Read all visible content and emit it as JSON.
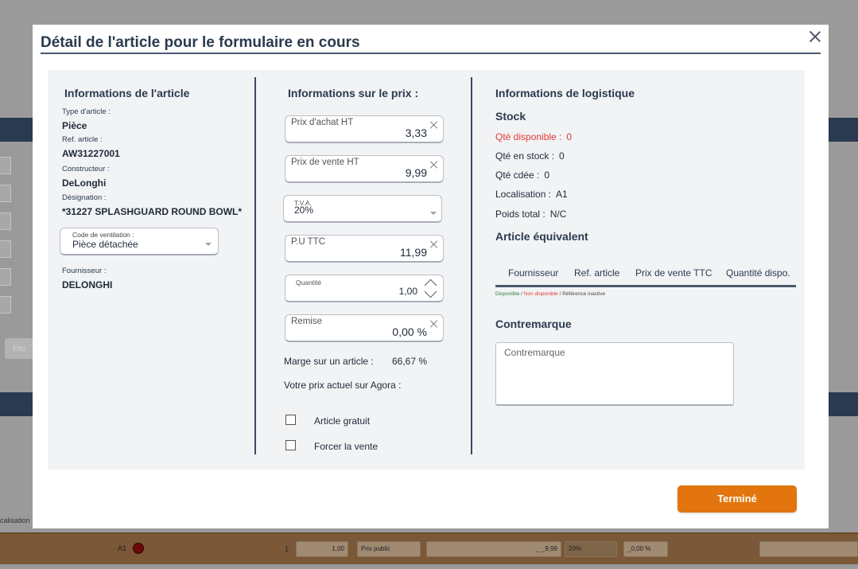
{
  "background": {
    "effacer_label": "Effa",
    "localisation_label": "calisation",
    "row": {
      "location": "A1",
      "qty_index": "1",
      "qty": "1,00",
      "price_type": "Prix public",
      "price": "_ _9,99",
      "tva": "20%",
      "remise": "_0,00 %"
    }
  },
  "modal": {
    "title": "Détail de l'article pour le formulaire en cours",
    "article": {
      "heading": "Informations de l'article",
      "type_label": "Type d'article :",
      "type_value": "Pièce",
      "ref_label": "Ref. article :",
      "ref_value": "AW31227001",
      "constructeur_label": "Constructeur :",
      "constructeur_value": "DeLonghi",
      "designation_label": "Désignation :",
      "designation_value": "*31227 SPLASHGUARD ROUND BOWL*",
      "ventilation_label": "Code de ventilation :",
      "ventilation_value": "Pièce détachée",
      "fournisseur_label": "Fournisseur :",
      "fournisseur_value": "DELONGHI"
    },
    "prix": {
      "heading": "Informations sur le prix :",
      "achat_label": "Prix d'achat HT",
      "achat_value": "3,33",
      "vente_label": "Prix de vente HT",
      "vente_value": "9,99",
      "tva_label": "T.V.A.",
      "tva_value": "20%",
      "puttc_label": "P.U TTC",
      "puttc_value": "11,99",
      "quantite_label": "Quantité",
      "quantite_value": "1,00",
      "remise_label": "Remise",
      "remise_value": "0,00 %",
      "marge_label": "Marge sur un article :",
      "marge_value": "66,67 %",
      "agora_label": "Votre prix actuel sur Agora :",
      "gratuit_label": "Article gratuit",
      "forcer_label": "Forcer la vente"
    },
    "logistique": {
      "heading": "Informations de logistique",
      "stock_heading": "Stock",
      "dispo_label": "Qté disponible :",
      "dispo_value": "0",
      "enstock_label": "Qté en stock :",
      "enstock_value": "0",
      "cdee_label": "Qté cdée :",
      "cdee_value": "0",
      "localisation_label": "Localisation :",
      "localisation_value": "A1",
      "poids_label": "Poids total :",
      "poids_value": "N/C",
      "equivalent_heading": "Article équivalent",
      "columns": [
        "Fournisseur",
        "Ref. article",
        "Prix de vente TTC",
        "Quantité dispo."
      ],
      "legend_dispo": "Disponible",
      "legend_sep1": " / ",
      "legend_nondispo": "Non disponible",
      "legend_sep2": " / ",
      "legend_inactive": "Référence inactive",
      "contremarque_heading": "Contremarque",
      "contremarque_placeholder": "Contremarque"
    },
    "done_label": "Terminé"
  },
  "colors": {
    "accent": "#e2750e",
    "navy": "#2b3a4e",
    "red": "#e53935",
    "green": "#2e7d32"
  }
}
